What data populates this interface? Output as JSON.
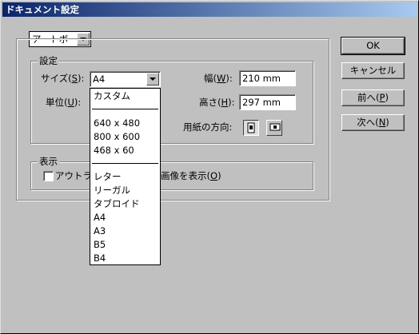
{
  "window": {
    "title": "ドキュメント設定"
  },
  "section_select": {
    "value": "アートボード"
  },
  "settings_group": {
    "title": "設定",
    "size_label": "サイズ(",
    "size_key": "S",
    "size_label_end": "):",
    "size_value": "A4",
    "unit_label": "単位(",
    "unit_key": "U",
    "unit_label_end": "):",
    "width_label": "幅(",
    "width_key": "W",
    "width_label_end": "):",
    "width_value": "210 mm",
    "height_label": "高さ(",
    "height_key": "H",
    "height_label_end": "):",
    "height_value": "297 mm",
    "orientation_label": "用紙の方向:"
  },
  "size_dropdown": {
    "group1": [
      "カスタム"
    ],
    "group2": [
      "640 x 480",
      "800 x 600",
      "468 x 60"
    ],
    "group3": [
      "レター",
      "リーガル",
      "タブロイド",
      "A4",
      "A3",
      "B5",
      "B4"
    ]
  },
  "display_group": {
    "title": "表示",
    "outline_prefix": "アウトライ",
    "image_suffix_text": "画像を表示(",
    "image_suffix_key": "O",
    "image_suffix_end": ")"
  },
  "buttons": {
    "ok": "OK",
    "cancel": "キャンセル",
    "prev_text": "前へ(",
    "prev_key": "P",
    "prev_end": ")",
    "next_text": "次へ(",
    "next_key": "N",
    "next_end": ")"
  },
  "icons": [
    "portrait-orientation-icon",
    "landscape-orientation-icon",
    "dropdown-arrow-icon"
  ]
}
